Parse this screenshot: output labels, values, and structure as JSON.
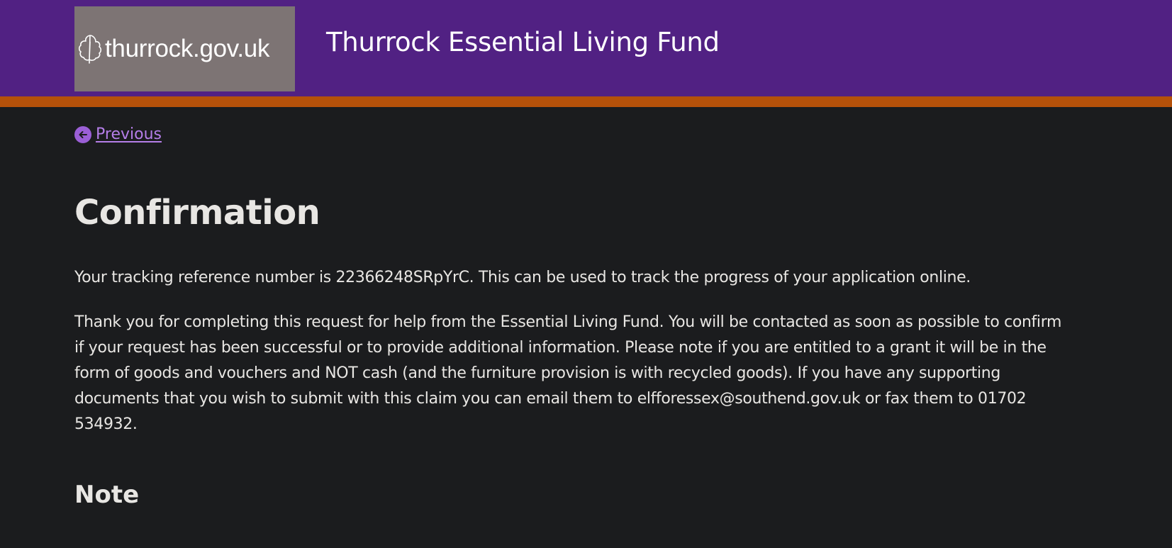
{
  "header": {
    "logo_text": "thurrock.gov.uk",
    "site_title": "Thurrock Essential Living Fund",
    "background_color": "#512183",
    "stripe_color": "#b5510a"
  },
  "nav": {
    "previous_label": "Previous",
    "previous_icon": "arrow-left-circle-icon"
  },
  "main": {
    "title": "Confirmation",
    "reference_text": "Your tracking reference number is 22366248SRpYrC. This can be used to track the progress of your application online.",
    "thanks_text": "Thank you for completing this request for help from the Essential Living Fund. You will be contacted as soon as possible to confirm if your request has been successful or to provide additional information. Please note if you are entitled to a grant it will be in the form of goods and vouchers and NOT cash (and the furniture provision is with recycled goods). If you have any supporting documents that you wish to submit with this claim you can email them to elfforessex@southend.gov.uk or fax them to 01702 534932.",
    "note_heading": "Note"
  },
  "colors": {
    "page_background": "#1b1c1e",
    "text": "#e8e6e3",
    "link": "#b57ee8"
  }
}
